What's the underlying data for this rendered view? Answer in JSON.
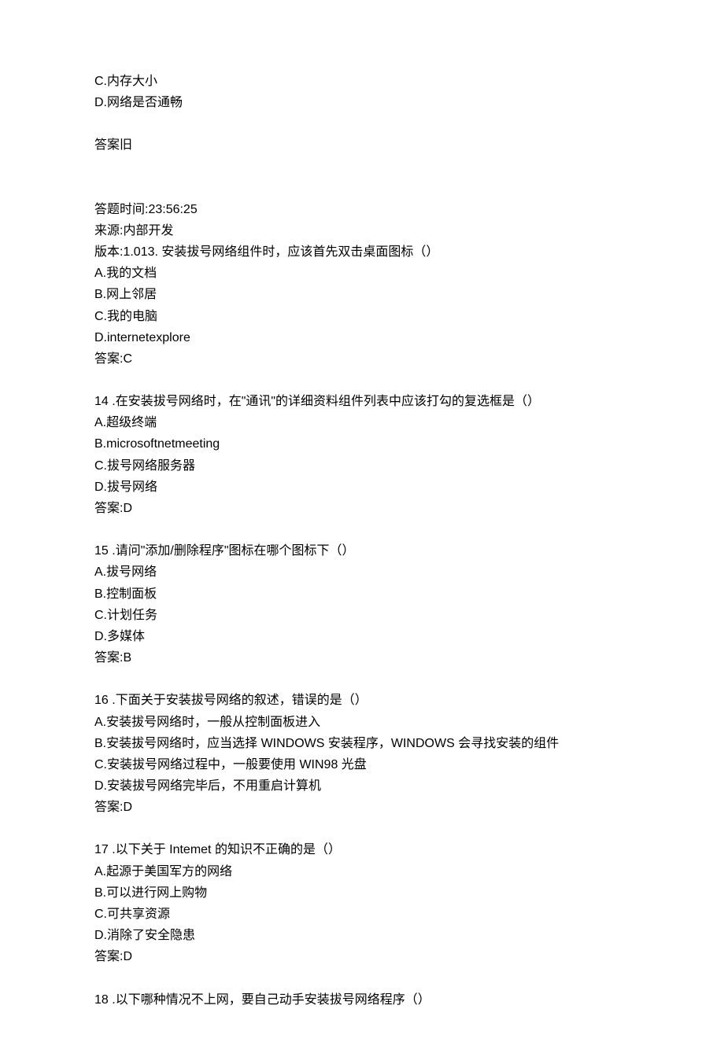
{
  "q_prev": {
    "opt_c": "C.内存大小",
    "opt_d": "D.网络是否通畅",
    "answer_label": "答案旧"
  },
  "meta": {
    "time_label": "答题时间:23:56:25",
    "source_label": "来源:内部开发",
    "version_prefix": "版本:1.013. 安装拔号网络组件时，应该首先双击桌面图标（）"
  },
  "q13": {
    "opt_a": "A.我的文档",
    "opt_b": "B.网上邻居",
    "opt_c": "C.我的电脑",
    "opt_d": "D.internetexplore",
    "answer": "答案:C"
  },
  "q14": {
    "stem": "14  .在安装拔号网络时，在\"通讯\"的详细资料组件列表中应该打勾的复选框是（）",
    "opt_a": "A.超级终端",
    "opt_b": "B.microsoftnetmeeting",
    "opt_c": "C.拔号网络服务器",
    "opt_d": "D.拔号网络",
    "answer": "答案:D"
  },
  "q15": {
    "stem": "15  .请问\"添加/删除程序\"图标在哪个图标下（）",
    "opt_a": "A.拔号网络",
    "opt_b": "B.控制面板",
    "opt_c": "C.计划任务",
    "opt_d": "D.多媒体",
    "answer": "答案:B"
  },
  "q16": {
    "stem": "16  .下面关于安装拔号网络的叙述，错误的是（）",
    "opt_a": "A.安装拔号网络时，一般从控制面板进入",
    "opt_b": "B.安装拔号网络时，应当选择 WINDOWS 安装程序，WINDOWS 会寻找安装的组件",
    "opt_c": "C.安装拔号网络过程中，一般要使用 WIN98 光盘",
    "opt_d": "D.安装拔号网络完毕后，不用重启计算机",
    "answer": "答案:D"
  },
  "q17": {
    "stem": "17  .以下关于 Intemet 的知识不正确的是（）",
    "opt_a": "A.起源于美国军方的网络",
    "opt_b": "B.可以进行网上购物",
    "opt_c": "C.可共享资源",
    "opt_d": "D.消除了安全隐患",
    "answer": "答案:D"
  },
  "q18": {
    "stem": "18  .以下哪种情况不上网，要自己动手安装拔号网络程序（）"
  }
}
